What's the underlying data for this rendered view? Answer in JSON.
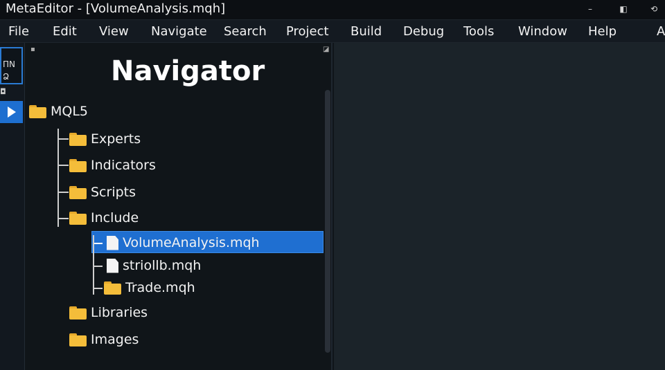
{
  "window": {
    "title": "MetaEditor - [VolumeAnalysis.mqh]",
    "controls": {
      "minimize": "–",
      "maximize": "◧",
      "close": "⟲"
    }
  },
  "menu": {
    "items": [
      "File",
      "Edit",
      "View",
      "Navigate",
      "Search",
      "Project",
      "Build",
      "Debug",
      "Tools",
      "Window",
      "Help"
    ],
    "overflow": "A"
  },
  "left_strip": {
    "line1": "ΠΝ",
    "line2": "Ձ",
    "small_icon": "◘"
  },
  "navigator": {
    "title": "Navigator",
    "pin_left": "▪",
    "pin_right": "◪",
    "tree": {
      "root": "MQL5",
      "children": [
        "Experts",
        "Indicators",
        "Scripts",
        "Include"
      ],
      "include_children": [
        "VolumeAnalysis.mqh",
        "striollb.mqh",
        "Trade.mqh"
      ],
      "after": [
        "Libraries",
        "Images"
      ],
      "selected": "VolumeAnalysis.mqh"
    }
  },
  "colors": {
    "selection": "#1f6fd1",
    "folder": "#f4bd3a",
    "editor_bg": "#1b2329"
  }
}
